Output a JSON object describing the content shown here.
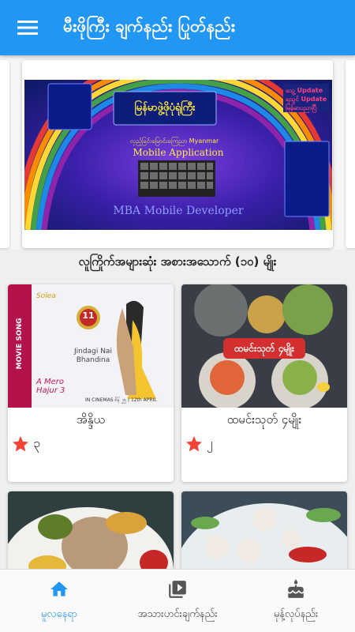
{
  "appbar": {
    "title": "မီးဖိုကြီး ချက်နည်း ပြုတ်နည်း",
    "menu_icon": "hamburger-menu-icon"
  },
  "banner": {
    "headline": "မြန်မာဖွဲ့ဖိုပုံရုံကြီး",
    "subline": "လှည့်ခြင်းမြောင်းကြေညာ Myanmar",
    "app_label": "Mobile Application",
    "badge_text": "သွေ့ Update ရသွင် Update မြန်မာပညာပြီ",
    "developer": "MBA Mobile Developer"
  },
  "section": {
    "heading": "လူကြိုက်အများဆုံး အစားအသောက် (၁၀) မျိုး"
  },
  "cards": [
    {
      "title": "အိန္ဒိယ",
      "rating": "၃",
      "poster_brand": "Solea",
      "poster_song": "Jindagi Nai Bhandina",
      "poster_tag": "MOVIE SONG",
      "poster_film": "A Mero Hajur 3",
      "poster_date": "IN CINEMAS စိန် ၂၅ | 12th APRIL",
      "poster_badge": "11"
    },
    {
      "title": "ထမင်းသုတ် ၄မျိုး",
      "rating": "၂",
      "overlay_text": "ထမင်းသုတ် ၄မျိုး"
    },
    {
      "title": "",
      "rating": ""
    },
    {
      "title": "",
      "rating": ""
    }
  ],
  "nav": [
    {
      "label": "မူလနေရာ",
      "icon": "home-icon",
      "active": true
    },
    {
      "label": "အသားဟင်းချက်နည်း",
      "icon": "video-library-icon",
      "active": false
    },
    {
      "label": "မုန့်လုပ်နည်း",
      "icon": "cake-icon",
      "active": false
    }
  ],
  "colors": {
    "primary": "#2196f3",
    "star": "#f44336"
  }
}
